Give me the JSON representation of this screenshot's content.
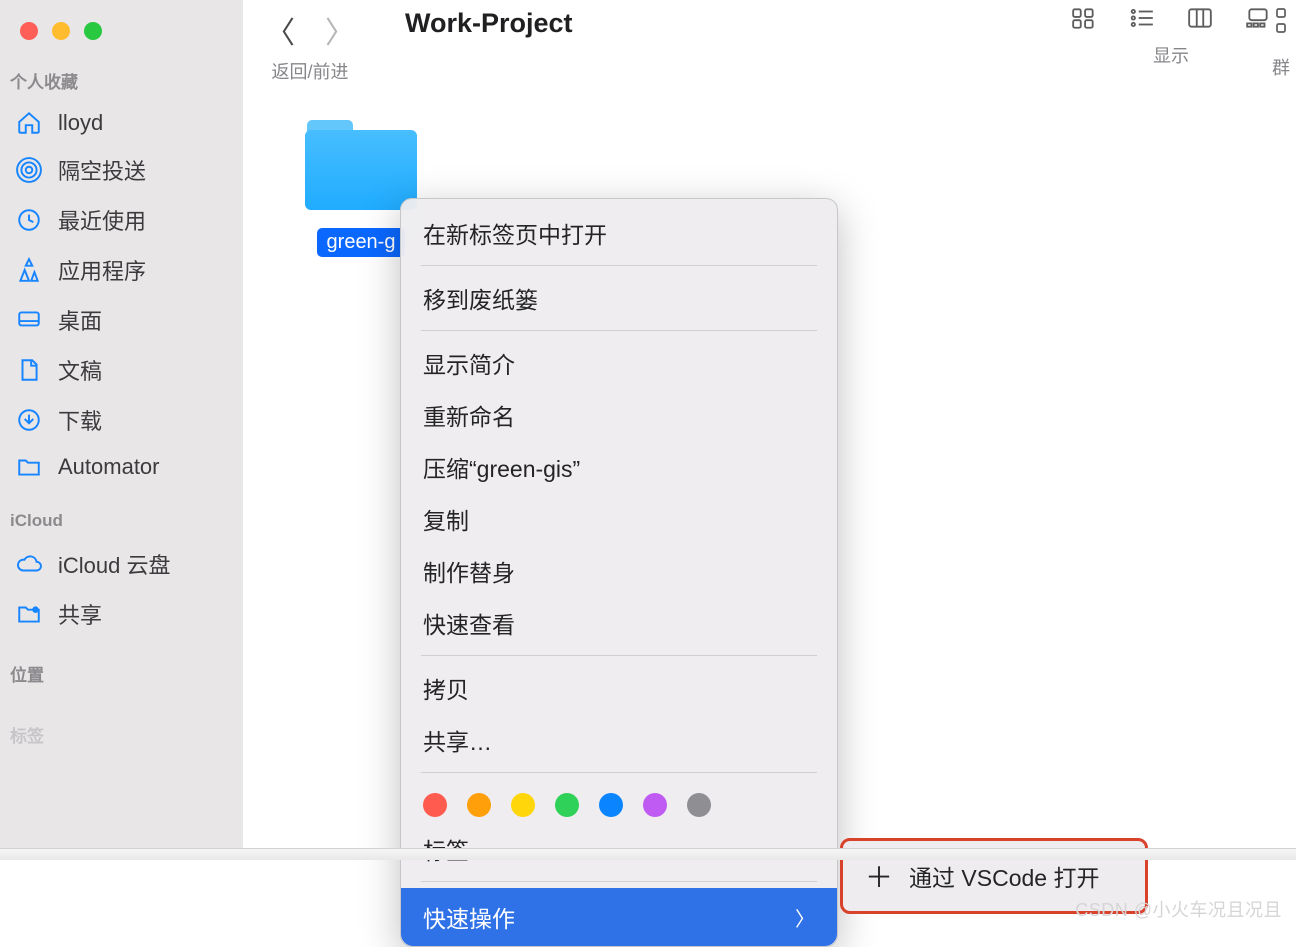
{
  "window_title": "Work-Project",
  "nav_label": "返回/前进",
  "view_label": "显示",
  "sidebar": {
    "section1": "个人收藏",
    "items": [
      {
        "label": "lloyd"
      },
      {
        "label": "隔空投送"
      },
      {
        "label": "最近使用"
      },
      {
        "label": "应用程序"
      },
      {
        "label": "桌面"
      },
      {
        "label": "文稿"
      },
      {
        "label": "下载"
      },
      {
        "label": "Automator"
      }
    ],
    "section2": "iCloud",
    "icloud_items": [
      {
        "label": "iCloud 云盘"
      },
      {
        "label": "共享"
      }
    ],
    "section3": "位置",
    "section4": "标签"
  },
  "selected_folder": "green-g",
  "context_menu": {
    "g1": [
      "在新标签页中打开"
    ],
    "g2": [
      "移到废纸篓"
    ],
    "g3": [
      "显示简介",
      "重新命名",
      "压缩“green-gis”",
      "复制",
      "制作替身",
      "快速查看"
    ],
    "g4": [
      "拷贝",
      "共享…"
    ],
    "tags_label": "标签…",
    "quick": "快速操作"
  },
  "submenu": {
    "label": "通过 VSCode 打开"
  },
  "tag_colors": [
    "#ff5b4e",
    "#ff9f0a",
    "#ffd60a",
    "#30d158",
    "#0a84ff",
    "#bf5af2",
    "#8e8e93"
  ],
  "watermark": "CSDN @小火车况且况且"
}
